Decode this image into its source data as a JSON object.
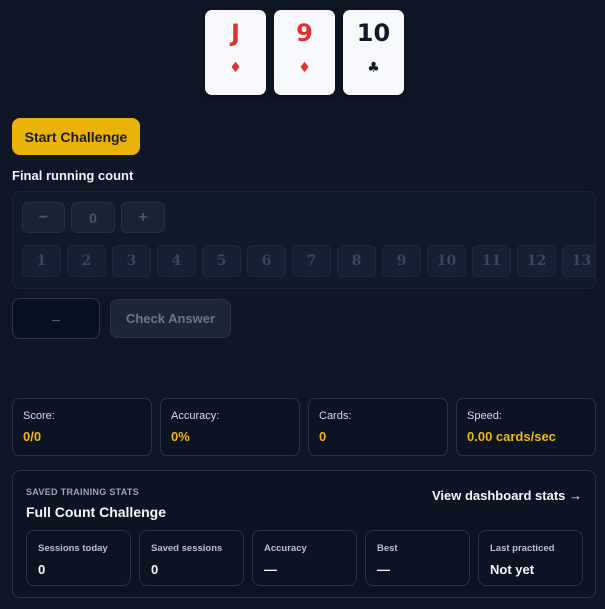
{
  "cards": [
    {
      "rank": "J",
      "suit": "♦",
      "color": "red"
    },
    {
      "rank": "9",
      "suit": "♦",
      "color": "red"
    },
    {
      "rank": "10",
      "suit": "♣",
      "color": "black"
    }
  ],
  "start_button": "Start Challenge",
  "count": {
    "label": "Final running count",
    "minus": "−",
    "value": "0",
    "plus": "+",
    "numbers": [
      "1",
      "2",
      "3",
      "4",
      "5",
      "6",
      "7",
      "8",
      "9",
      "10",
      "11",
      "12",
      "13"
    ]
  },
  "answer": {
    "placeholder": "–",
    "check_label": "Check Answer"
  },
  "stats": [
    {
      "label": "Score:",
      "value": "0/0"
    },
    {
      "label": "Accuracy:",
      "value": "0%"
    },
    {
      "label": "Cards:",
      "value": "0"
    },
    {
      "label": "Speed:",
      "value": "0.00 cards/sec"
    }
  ],
  "saved": {
    "kicker": "SAVED TRAINING STATS",
    "title": "Full Count Challenge",
    "link": "View dashboard stats →",
    "items": [
      {
        "label": "Sessions today",
        "value": "0"
      },
      {
        "label": "Saved sessions",
        "value": "0"
      },
      {
        "label": "Accuracy",
        "value": "—"
      },
      {
        "label": "Best",
        "value": "—"
      },
      {
        "label": "Last practiced",
        "value": "Not yet"
      }
    ]
  },
  "colors": {
    "accent": "#e9b308",
    "background": "#0f1626",
    "card_red": "#e03131",
    "stat_value": "#f0b90b"
  }
}
